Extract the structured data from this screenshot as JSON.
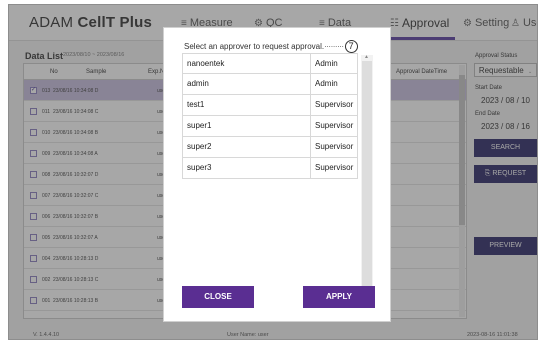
{
  "app": {
    "name_prefix": "ADAM ",
    "name_bold": "CellT Plus"
  },
  "nav": [
    {
      "icon": "≡",
      "label": "Measure"
    },
    {
      "icon": "⚙",
      "label": "QC"
    },
    {
      "icon": "≡",
      "label": "Data"
    },
    {
      "icon": "☷",
      "label": "Approval"
    },
    {
      "icon": "⚙",
      "label": "Setting"
    },
    {
      "icon": "♙",
      "label": "User"
    }
  ],
  "data_list": {
    "title": "Data List",
    "range": "2023/08/10 ~ 2023/08/16",
    "headers": {
      "no": "No",
      "sample": "Sample",
      "exp": "Exp.Nar",
      "approval_time": "Approval DateTime"
    },
    "rows": [
      {
        "no": "013",
        "sample": "23/08/16 10:34:08 D",
        "exp": "user"
      },
      {
        "no": "011",
        "sample": "23/08/16 10:34:08 C",
        "exp": "user"
      },
      {
        "no": "010",
        "sample": "23/08/16 10:34:08 B",
        "exp": "user"
      },
      {
        "no": "009",
        "sample": "23/08/16 10:34:08 A",
        "exp": "user"
      },
      {
        "no": "008",
        "sample": "23/08/16 10:32:07 D",
        "exp": "user"
      },
      {
        "no": "007",
        "sample": "23/08/16 10:32:07 C",
        "exp": "user"
      },
      {
        "no": "006",
        "sample": "23/08/16 10:32:07 B",
        "exp": "user"
      },
      {
        "no": "005",
        "sample": "23/08/16 10:32:07 A",
        "exp": "user"
      },
      {
        "no": "004",
        "sample": "23/08/16 10:28:13 D",
        "exp": "user"
      },
      {
        "no": "002",
        "sample": "23/08/16 10:28:13 C",
        "exp": "user"
      },
      {
        "no": "001",
        "sample": "23/08/16 10:28:13 B",
        "exp": "user"
      }
    ]
  },
  "right_panel": {
    "approval_status_label": "Approval Status",
    "approval_status_value": "Requestable",
    "start_date_label": "Start Date",
    "start_date_value": "2023 / 08 / 10",
    "end_date_label": "End Date",
    "end_date_value": "2023 / 08 / 16",
    "search_label": "SEARCH",
    "request_label": "REQUEST",
    "preview_label": "PREVIEW"
  },
  "footer": {
    "version": "V. 1.4.4.10",
    "user": "User Name: user",
    "datetime": "2023-08-16 11:01:38"
  },
  "modal": {
    "title": "Select an approver to request approval.",
    "callout": "7",
    "approvers": [
      {
        "name": "nanoentek",
        "role": "Admin"
      },
      {
        "name": "admin",
        "role": "Admin"
      },
      {
        "name": "test1",
        "role": "Supervisor"
      },
      {
        "name": "super1",
        "role": "Supervisor"
      },
      {
        "name": "super2",
        "role": "Supervisor"
      },
      {
        "name": "super3",
        "role": "Supervisor"
      }
    ],
    "close_label": "CLOSE",
    "apply_label": "APPLY"
  }
}
